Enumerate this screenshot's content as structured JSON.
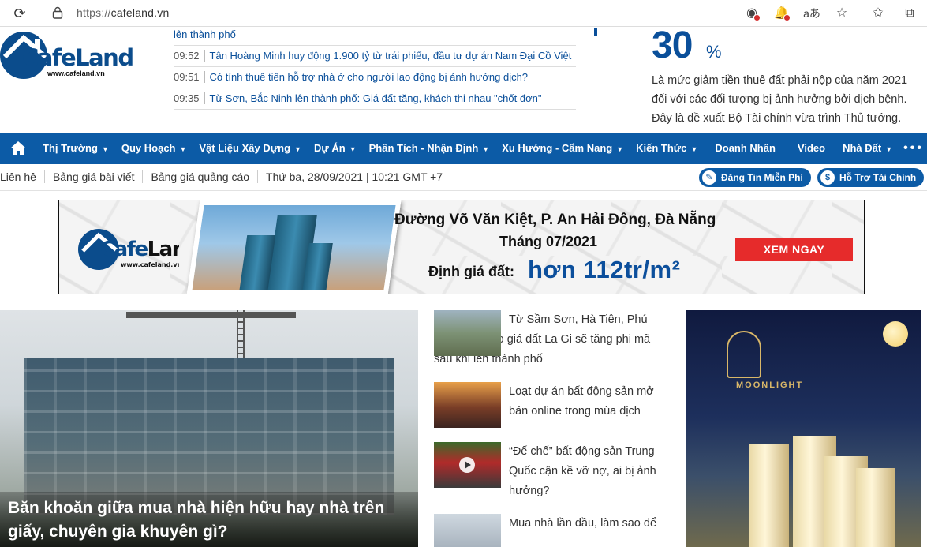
{
  "browser": {
    "url_scheme": "https://",
    "url_host": "cafeland.vn"
  },
  "header": {
    "logo_brand": "CafeLand",
    "logo_domain": "www.cafeland.vn",
    "headlines": [
      {
        "time": "",
        "title": "lên thành phố"
      },
      {
        "time": "09:52",
        "title": "Tân Hoàng Minh huy động 1.900 tỷ từ trái phiếu, đầu tư dự án Nam Đại Cồ Việt"
      },
      {
        "time": "09:51",
        "title": "Có tính thuế tiền hỗ trợ nhà ở cho người lao động bị ảnh hưởng dịch?"
      },
      {
        "time": "09:35",
        "title": "Từ Sơn, Bắc Ninh lên thành phố: Giá đất tăng, khách thi nhau \"chốt đơn\""
      }
    ],
    "stat_value": "30",
    "stat_unit": "%",
    "stat_desc": "Là mức giảm tiền thuê đất phải nộp của năm 2021 đối với các đối tượng bị ảnh hưởng bởi dịch bệnh. Đây là đề xuất Bộ Tài chính vừa trình Thủ tướng."
  },
  "nav": {
    "items": [
      {
        "label": "Thị Trường",
        "caret": true
      },
      {
        "label": "Quy Hoạch",
        "caret": true
      },
      {
        "label": "Vật Liệu Xây Dựng",
        "caret": true
      },
      {
        "label": "Dự Án",
        "caret": true
      },
      {
        "label": "Phân Tích - Nhận Định",
        "caret": true
      },
      {
        "label": "Xu Hướng - Cẩm Nang",
        "caret": true
      },
      {
        "label": "Kiến Thức",
        "caret": true
      },
      {
        "label": "Doanh Nhân",
        "caret": false
      },
      {
        "label": "Video",
        "caret": false
      },
      {
        "label": "Nhà Đất",
        "caret": true
      }
    ],
    "more": "•••"
  },
  "subbar": {
    "links": [
      "Liên hệ",
      "Bảng giá bài viết",
      "Bảng giá quảng cáo",
      "Thứ ba, 28/09/2021 | 10:21 GMT +7"
    ],
    "post_button": "Đăng Tin Miễn Phí",
    "finance_button": "Hỗ Trợ Tài Chính"
  },
  "banner": {
    "title1": "Đường Võ Văn Kiệt, P. An Hải Đông, Đà Nẵng",
    "title2": "Tháng 07/2021",
    "label": "Định giá đất:",
    "price": "hơn 112tr/m²",
    "cta": "XEM NGAY"
  },
  "featured": {
    "caption": "Băn khoăn giữa mua nhà hiện hữu hay nhà trên giấy, chuyên gia khuyên gì?"
  },
  "side_articles": [
    {
      "title": "Từ Sầm Sơn, Hà Tiên, Phú Quốc, dự báo giá đất La Gi sẽ tăng phi mã sau khi lên thành phố"
    },
    {
      "title": "Loạt dự án bất động sản mở bán online trong mùa dịch"
    },
    {
      "title": "“Đế chế” bất động sản Trung Quốc cận kề vỡ nợ, ai bị ảnh hưởng?"
    },
    {
      "title": "Mua nhà lần đầu, làm sao để"
    }
  ],
  "ad": {
    "brand": "MOONLIGHT"
  },
  "colors": {
    "brand_blue": "#0c5ba6",
    "cta_red": "#e62b2b"
  }
}
